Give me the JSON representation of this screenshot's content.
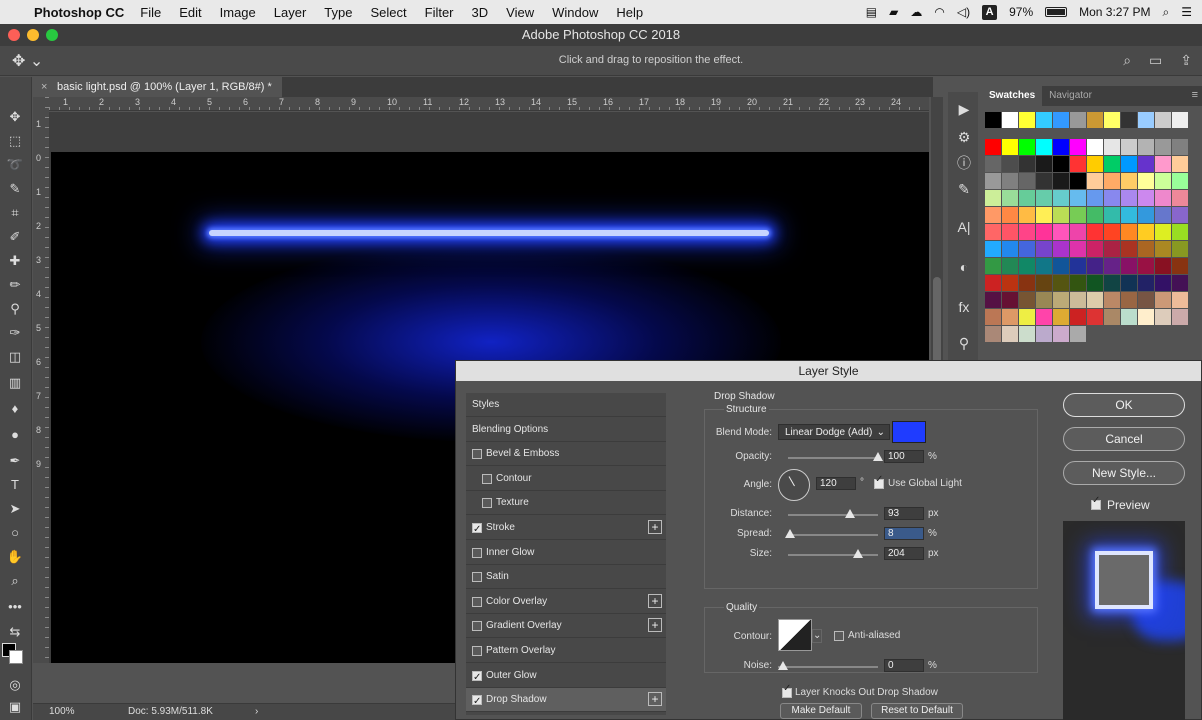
{
  "menubar": {
    "app_name": "Photoshop CC",
    "items": [
      "File",
      "Edit",
      "Image",
      "Layer",
      "Type",
      "Select",
      "Filter",
      "3D",
      "View",
      "Window",
      "Help"
    ],
    "battery": "97%",
    "clock": "Mon 3:27 PM",
    "input_source": "A"
  },
  "window": {
    "title": "Adobe Photoshop CC 2018"
  },
  "options_bar": {
    "hint": "Click and drag to reposition the effect."
  },
  "document": {
    "tab_title": "basic light.psd @ 100% (Layer 1, RGB/8#) *",
    "ruler_top": [
      "1",
      "2",
      "3",
      "4",
      "5",
      "6",
      "7",
      "8",
      "9",
      "10",
      "11",
      "12",
      "13",
      "14",
      "15",
      "16",
      "17",
      "18",
      "19",
      "20",
      "21",
      "22",
      "23",
      "24"
    ],
    "ruler_left": [
      "1",
      "0",
      "1",
      "2",
      "3",
      "4",
      "5",
      "6",
      "7",
      "8",
      "9"
    ],
    "zoom": "100%",
    "doc_info": "Doc: 5.93M/511.8K",
    "status_arrow": "›"
  },
  "swatches_panel": {
    "tabs": [
      "Swatches",
      "Navigator"
    ],
    "rows": [
      [
        "#000000",
        "#ffffff",
        "#ffff33",
        "#33ccff",
        "#3399ff",
        "#999999",
        "#cc9933",
        "#ffff66",
        "#333333",
        "#99ccff",
        "#cccccc",
        "#eeeeee"
      ],
      [
        "#ff0000",
        "#ffff00",
        "#00ff00",
        "#00ffff",
        "#0000ff",
        "#ff00ff",
        "#ffffff",
        "#e6e6e6",
        "#cccccc",
        "#b3b3b3",
        "#999999",
        "#808080"
      ],
      [
        "#666666",
        "#4d4d4d",
        "#333333",
        "#1a1a1a",
        "#000000",
        "#ff3333",
        "#ffcc00",
        "#00cc66",
        "#0099ff",
        "#6633cc",
        "#ff99cc",
        "#ffcc99"
      ],
      [
        "#999999",
        "#808080",
        "#666666",
        "#333333",
        "#1a1a1a",
        "#000000",
        "#ffcc99",
        "#ffaa66",
        "#ffcc66",
        "#ffff99",
        "#ccff99",
        "#99ff99"
      ],
      [
        "#ccee99",
        "#99dd99",
        "#66cc99",
        "#66ccaa",
        "#66cccc",
        "#66bbee",
        "#6699ee",
        "#8888ee",
        "#aa88ee",
        "#cc88ee",
        "#ee88cc",
        "#ee8899"
      ],
      [
        "#ff9966",
        "#ff8844",
        "#ffbb44",
        "#ffee55",
        "#bbdd55",
        "#77cc55",
        "#44bb66",
        "#33bbaa",
        "#33bbdd",
        "#3399dd",
        "#6677cc",
        "#8866cc"
      ],
      [
        "#ff6666",
        "#ff5566",
        "#ff4488",
        "#ff3399",
        "#ff55bb",
        "#ee44aa",
        "#ff3333",
        "#ff4422",
        "#ff8822",
        "#ffcc22",
        "#ddee22",
        "#99dd22"
      ],
      [
        "#22aaff",
        "#2288ee",
        "#4466dd",
        "#7744cc",
        "#aa33cc",
        "#dd33aa",
        "#cc2266",
        "#aa2244",
        "#aa3322",
        "#aa6622",
        "#aa8822",
        "#889922"
      ],
      [
        "#339944",
        "#228855",
        "#118866",
        "#117788",
        "#115599",
        "#223399",
        "#442288",
        "#662288",
        "#881166",
        "#991144",
        "#881122",
        "#883311"
      ],
      [
        "#cc2222",
        "#bb3311",
        "#883311",
        "#664411",
        "#555511",
        "#335511",
        "#115522",
        "#114444",
        "#113355",
        "#222266",
        "#331166",
        "#441155"
      ],
      [
        "#551144",
        "#661133",
        "#775533",
        "#998855",
        "#bbaa77",
        "#ccbb99",
        "#ddccaa",
        "#bb8866",
        "#996644",
        "#775544",
        "#cc9977",
        "#eebb99"
      ],
      [
        "#bb7755",
        "#dd9966",
        "#eeee44",
        "#ff44aa",
        "#ddaa33",
        "#cc2222",
        "#dd3333",
        "#aa8866",
        "#bbddcc",
        "#ffeecc",
        "#ddccbb",
        "#ccaaaa"
      ],
      [
        "#aa8877",
        "#ddccbb",
        "#ccddcc",
        "#bbaacc",
        "#ccaacc",
        "#aaaaaa"
      ]
    ]
  },
  "dialog": {
    "title": "Layer Style",
    "styles": [
      {
        "label": "Styles",
        "checkbox": null,
        "indent": false,
        "plus": false
      },
      {
        "label": "Blending Options",
        "checkbox": null,
        "indent": false,
        "plus": false
      },
      {
        "label": "Bevel & Emboss",
        "checkbox": false,
        "indent": false,
        "plus": false
      },
      {
        "label": "Contour",
        "checkbox": false,
        "indent": true,
        "plus": false
      },
      {
        "label": "Texture",
        "checkbox": false,
        "indent": true,
        "plus": false
      },
      {
        "label": "Stroke",
        "checkbox": true,
        "indent": false,
        "plus": true
      },
      {
        "label": "Inner Glow",
        "checkbox": false,
        "indent": false,
        "plus": false
      },
      {
        "label": "Satin",
        "checkbox": false,
        "indent": false,
        "plus": false
      },
      {
        "label": "Color Overlay",
        "checkbox": false,
        "indent": false,
        "plus": true
      },
      {
        "label": "Gradient Overlay",
        "checkbox": false,
        "indent": false,
        "plus": true
      },
      {
        "label": "Pattern Overlay",
        "checkbox": false,
        "indent": false,
        "plus": false
      },
      {
        "label": "Outer Glow",
        "checkbox": true,
        "indent": false,
        "plus": false
      },
      {
        "label": "Drop Shadow",
        "checkbox": true,
        "indent": false,
        "plus": true
      }
    ],
    "section_title": "Drop Shadow",
    "structure_label": "Structure",
    "blend_mode_label": "Blend Mode:",
    "blend_mode_value": "Linear Dodge (Add)",
    "shadow_color": "#1f3cff",
    "opacity_label": "Opacity:",
    "opacity_value": "100",
    "opacity_fraction": 1.0,
    "angle_label": "Angle:",
    "angle_value": "120",
    "degree_sign": "°",
    "global_light_label": "Use Global Light",
    "distance_label": "Distance:",
    "distance_value": "93",
    "spread_label": "Spread:",
    "spread_value": "8",
    "size_label": "Size:",
    "size_value": "204",
    "quality_label": "Quality",
    "contour_label": "Contour:",
    "anti_aliased_label": "Anti-aliased",
    "noise_label": "Noise:",
    "noise_value": "0",
    "unit_percent": "%",
    "unit_px": "px",
    "knocks_out_label": "Layer Knocks Out Drop Shadow",
    "make_default_label": "Make Default",
    "reset_default_label": "Reset to Default",
    "ok_label": "OK",
    "cancel_label": "Cancel",
    "new_style_label": "New Style...",
    "preview_label": "Preview"
  }
}
